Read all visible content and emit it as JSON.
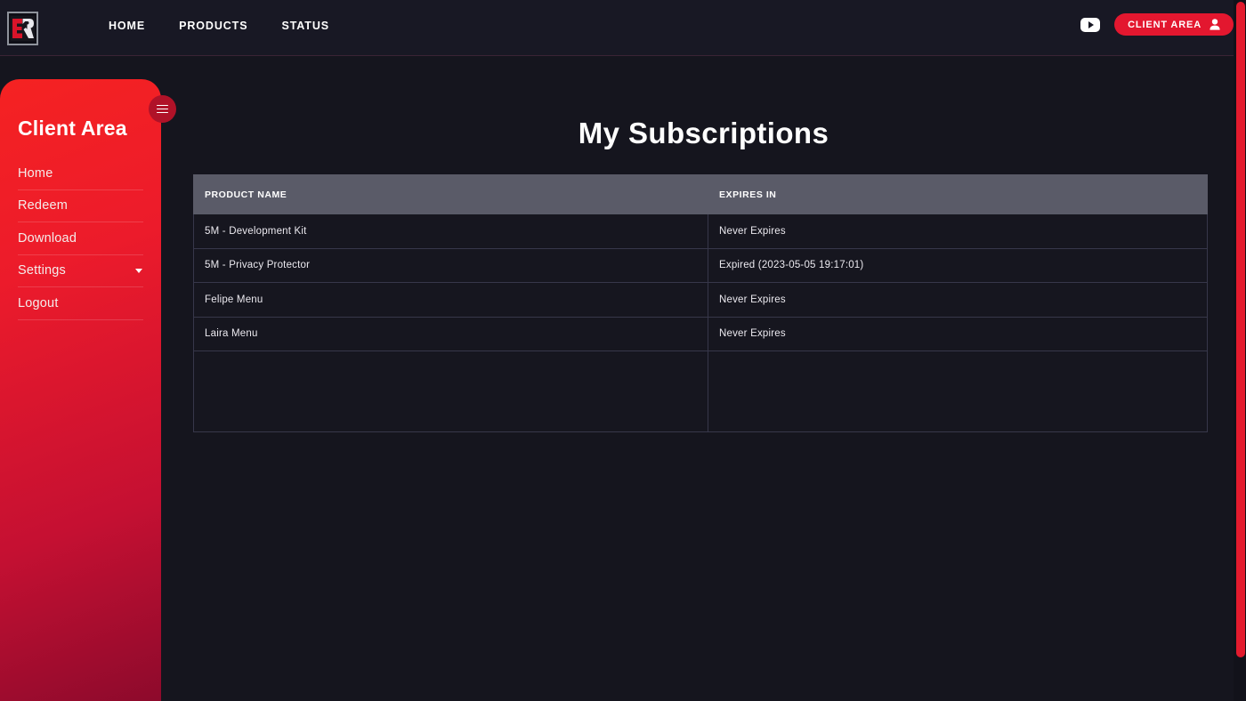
{
  "navbar": {
    "logo_alt": "ER",
    "links": [
      {
        "label": "HOME"
      },
      {
        "label": "PRODUCTS"
      },
      {
        "label": "STATUS"
      }
    ],
    "youtube_icon": "youtube-icon",
    "client_area_button": "CLIENT AREA",
    "person_icon": "person-icon"
  },
  "sidebar": {
    "title": "Client Area",
    "toggle_icon": "hamburger-icon",
    "items": [
      {
        "label": "Home",
        "has_caret": false
      },
      {
        "label": "Redeem",
        "has_caret": false
      },
      {
        "label": "Download",
        "has_caret": false
      },
      {
        "label": "Settings",
        "has_caret": true
      },
      {
        "label": "Logout",
        "has_caret": false
      }
    ]
  },
  "main": {
    "page_title": "My Subscriptions",
    "table": {
      "columns": [
        "PRODUCT NAME",
        "EXPIRES IN"
      ],
      "rows": [
        {
          "product_name": "5M - Development Kit",
          "expires_in": "Never Expires"
        },
        {
          "product_name": "5M - Privacy Protector",
          "expires_in": "Expired (2023-05-05 19:17:01)"
        },
        {
          "product_name": "Felipe Menu",
          "expires_in": "Never Expires"
        },
        {
          "product_name": "Laira Menu",
          "expires_in": "Never Expires"
        }
      ]
    }
  },
  "colors": {
    "accent_red": "#e3172f",
    "sidebar_red_top": "#f52222",
    "sidebar_red_bottom": "#8d0a2c",
    "page_background": "#15151e",
    "navbar_background": "#181824",
    "table_header": "#5a5b68",
    "table_row": "#16161f"
  }
}
